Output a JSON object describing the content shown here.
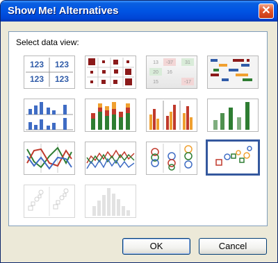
{
  "window": {
    "title": "Show Me! Alternatives",
    "close_icon": "close-icon"
  },
  "panel": {
    "label": "Select data view:"
  },
  "views": [
    {
      "name": "text-table",
      "texts": [
        "123",
        "123",
        "123",
        "123"
      ]
    },
    {
      "name": "heat-map"
    },
    {
      "name": "highlight-table",
      "texts": [
        "13",
        "-37",
        "31",
        "20",
        "16",
        "15",
        "-17"
      ]
    },
    {
      "name": "gantt-chart"
    },
    {
      "name": "side-by-side-bars"
    },
    {
      "name": "stacked-bars"
    },
    {
      "name": "measure-bars"
    },
    {
      "name": "horizontal-bars"
    },
    {
      "name": "lines-discrete"
    },
    {
      "name": "lines-continuous"
    },
    {
      "name": "circle-views"
    },
    {
      "name": "scatter-plot",
      "selected": true
    },
    {
      "name": "scatter-matrix",
      "disabled": true
    },
    {
      "name": "histogram",
      "disabled": true
    }
  ],
  "buttons": {
    "ok": "OK",
    "cancel": "Cancel"
  },
  "colors": {
    "title_bar": "#0054e3",
    "selection": "#34589e",
    "blue": "#3f6cc4",
    "red": "#c0392b",
    "green": "#2e7d32",
    "orange": "#f0a030"
  }
}
